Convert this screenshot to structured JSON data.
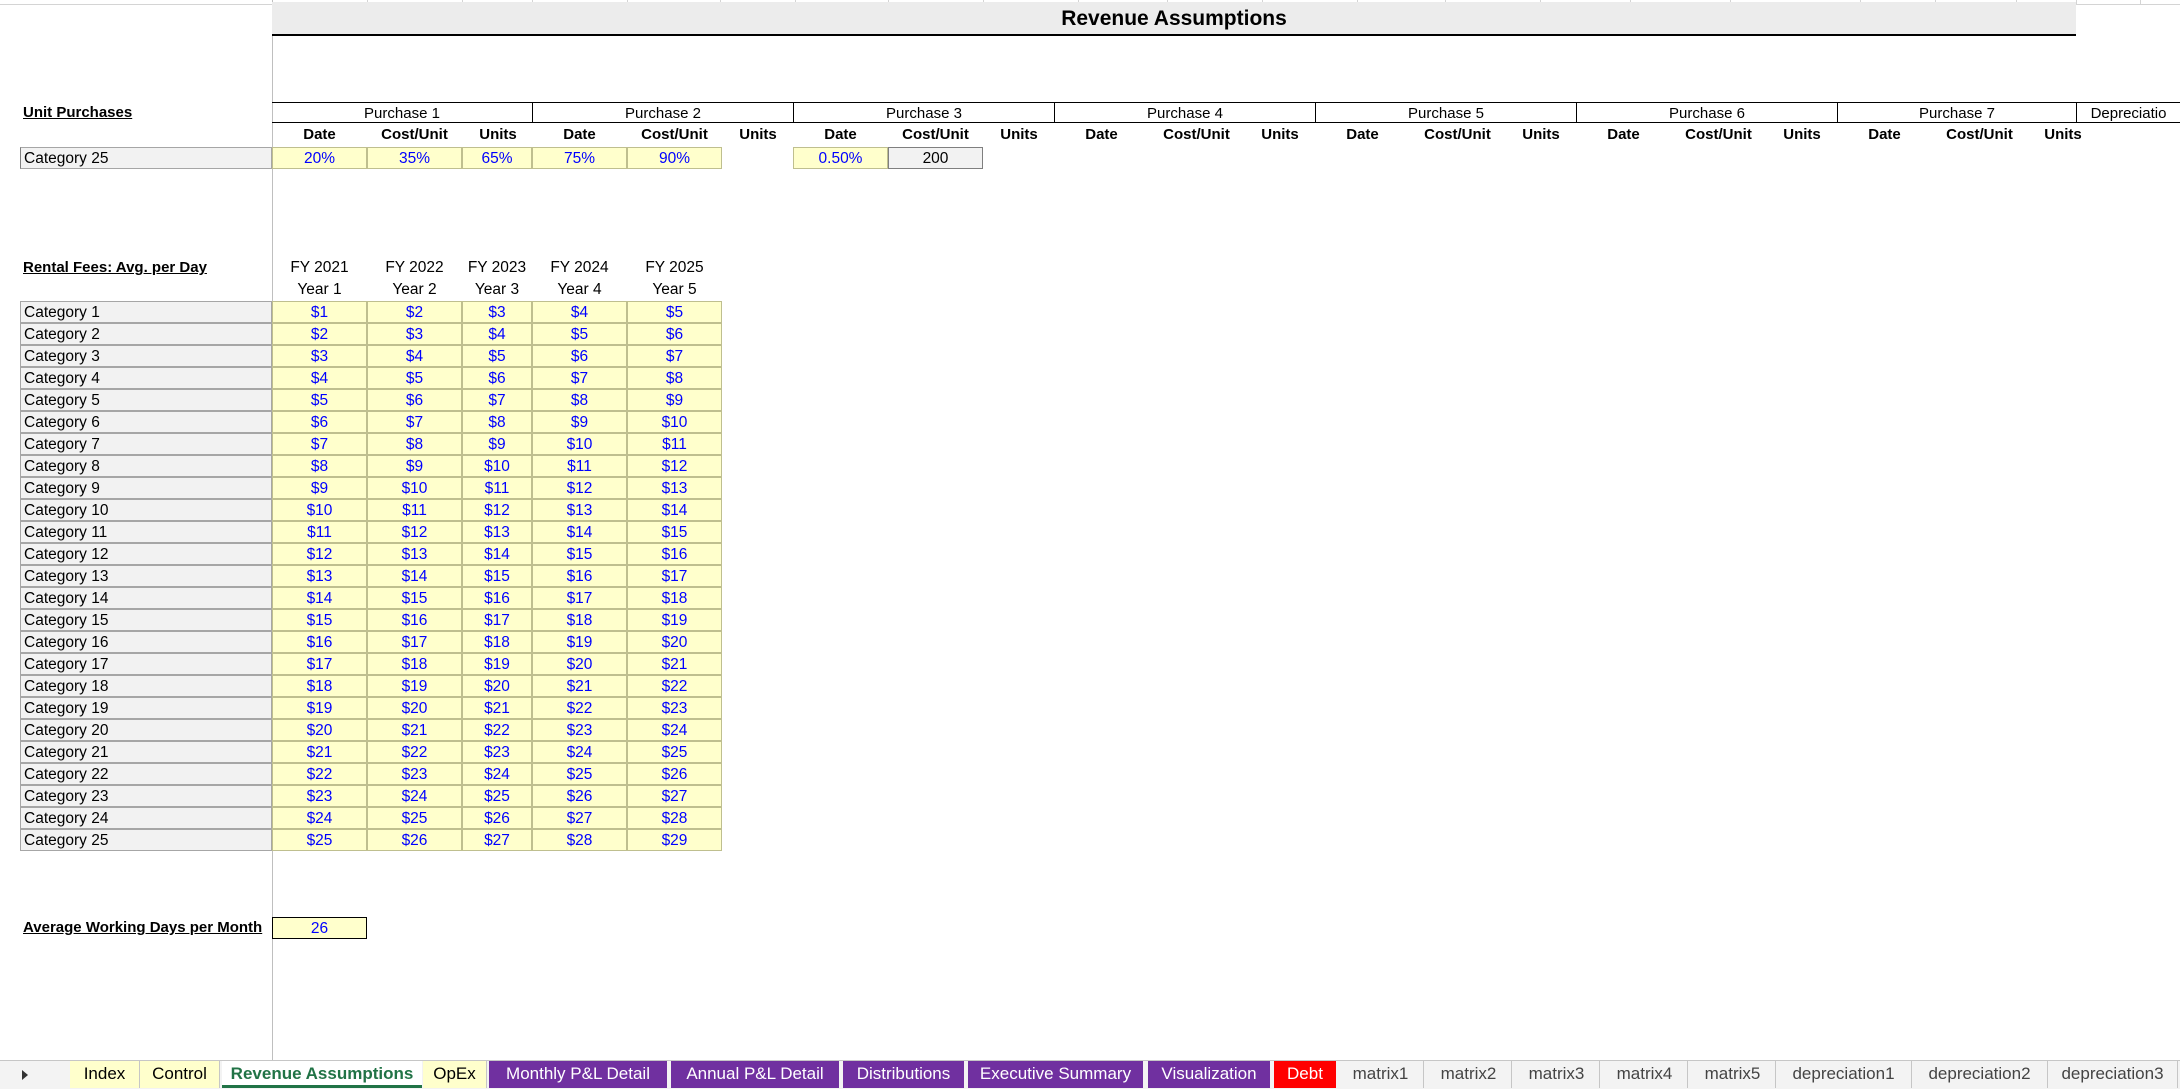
{
  "title": "Revenue Assumptions",
  "unit_purchases": {
    "label": "Unit Purchases",
    "groups": [
      "Purchase 1",
      "Purchase 2",
      "Purchase 3",
      "Purchase 4",
      "Purchase 5",
      "Purchase 6",
      "Purchase 7",
      "Depreciatio"
    ],
    "subheaders": [
      "Date",
      "Cost/Unit",
      "Units"
    ],
    "row": {
      "label": "Category 25",
      "values": [
        "20%",
        "35%",
        "65%",
        "75%",
        "90%"
      ],
      "extra": [
        "0.50%",
        "200"
      ]
    }
  },
  "rental": {
    "label": "Rental Fees: Avg. per Day",
    "fy": [
      "FY 2021",
      "FY 2022",
      "FY 2023",
      "FY 2024",
      "FY 2025"
    ],
    "years": [
      "Year 1",
      "Year 2",
      "Year 3",
      "Year 4",
      "Year 5"
    ],
    "rows": [
      {
        "label": "Category 1",
        "v": [
          "$1",
          "$2",
          "$3",
          "$4",
          "$5"
        ]
      },
      {
        "label": "Category 2",
        "v": [
          "$2",
          "$3",
          "$4",
          "$5",
          "$6"
        ]
      },
      {
        "label": "Category 3",
        "v": [
          "$3",
          "$4",
          "$5",
          "$6",
          "$7"
        ]
      },
      {
        "label": "Category 4",
        "v": [
          "$4",
          "$5",
          "$6",
          "$7",
          "$8"
        ]
      },
      {
        "label": "Category 5",
        "v": [
          "$5",
          "$6",
          "$7",
          "$8",
          "$9"
        ]
      },
      {
        "label": "Category 6",
        "v": [
          "$6",
          "$7",
          "$8",
          "$9",
          "$10"
        ]
      },
      {
        "label": "Category 7",
        "v": [
          "$7",
          "$8",
          "$9",
          "$10",
          "$11"
        ]
      },
      {
        "label": "Category 8",
        "v": [
          "$8",
          "$9",
          "$10",
          "$11",
          "$12"
        ]
      },
      {
        "label": "Category 9",
        "v": [
          "$9",
          "$10",
          "$11",
          "$12",
          "$13"
        ]
      },
      {
        "label": "Category 10",
        "v": [
          "$10",
          "$11",
          "$12",
          "$13",
          "$14"
        ]
      },
      {
        "label": "Category 11",
        "v": [
          "$11",
          "$12",
          "$13",
          "$14",
          "$15"
        ]
      },
      {
        "label": "Category 12",
        "v": [
          "$12",
          "$13",
          "$14",
          "$15",
          "$16"
        ]
      },
      {
        "label": "Category 13",
        "v": [
          "$13",
          "$14",
          "$15",
          "$16",
          "$17"
        ]
      },
      {
        "label": "Category 14",
        "v": [
          "$14",
          "$15",
          "$16",
          "$17",
          "$18"
        ]
      },
      {
        "label": "Category 15",
        "v": [
          "$15",
          "$16",
          "$17",
          "$18",
          "$19"
        ]
      },
      {
        "label": "Category 16",
        "v": [
          "$16",
          "$17",
          "$18",
          "$19",
          "$20"
        ]
      },
      {
        "label": "Category 17",
        "v": [
          "$17",
          "$18",
          "$19",
          "$20",
          "$21"
        ]
      },
      {
        "label": "Category 18",
        "v": [
          "$18",
          "$19",
          "$20",
          "$21",
          "$22"
        ]
      },
      {
        "label": "Category 19",
        "v": [
          "$19",
          "$20",
          "$21",
          "$22",
          "$23"
        ]
      },
      {
        "label": "Category 20",
        "v": [
          "$20",
          "$21",
          "$22",
          "$23",
          "$24"
        ]
      },
      {
        "label": "Category 21",
        "v": [
          "$21",
          "$22",
          "$23",
          "$24",
          "$25"
        ]
      },
      {
        "label": "Category 22",
        "v": [
          "$22",
          "$23",
          "$24",
          "$25",
          "$26"
        ]
      },
      {
        "label": "Category 23",
        "v": [
          "$23",
          "$24",
          "$25",
          "$26",
          "$27"
        ]
      },
      {
        "label": "Category 24",
        "v": [
          "$24",
          "$25",
          "$26",
          "$27",
          "$28"
        ]
      },
      {
        "label": "Category 25",
        "v": [
          "$25",
          "$26",
          "$27",
          "$28",
          "$29"
        ]
      }
    ]
  },
  "working_days": {
    "label": "Average Working Days per Month",
    "value": "26"
  },
  "tabs": [
    {
      "label": "Index",
      "style": "yellow"
    },
    {
      "label": "Control",
      "style": "yellow"
    },
    {
      "label": "Revenue Assumptions",
      "style": "active"
    },
    {
      "label": "OpEx",
      "style": "yellow"
    },
    {
      "label": "Monthly P&L Detail",
      "style": "purple"
    },
    {
      "label": "Annual P&L Detail",
      "style": "purple"
    },
    {
      "label": "Distributions",
      "style": "purple"
    },
    {
      "label": "Executive Summary",
      "style": "purple"
    },
    {
      "label": "Visualization",
      "style": "purple"
    },
    {
      "label": "Debt",
      "style": "red"
    },
    {
      "label": "matrix1",
      "style": "plain"
    },
    {
      "label": "matrix2",
      "style": "plain"
    },
    {
      "label": "matrix3",
      "style": "plain"
    },
    {
      "label": "matrix4",
      "style": "plain"
    },
    {
      "label": "matrix5",
      "style": "plain"
    },
    {
      "label": "depreciation1",
      "style": "plain"
    },
    {
      "label": "depreciation2",
      "style": "plain"
    },
    {
      "label": "depreciation3",
      "style": "plain"
    }
  ],
  "colors": {
    "input_fill": "#ffffcc",
    "input_text": "#0000ff",
    "tab_purple": "#7030a0",
    "tab_red": "#ff0000",
    "tab_active": "#217346"
  }
}
